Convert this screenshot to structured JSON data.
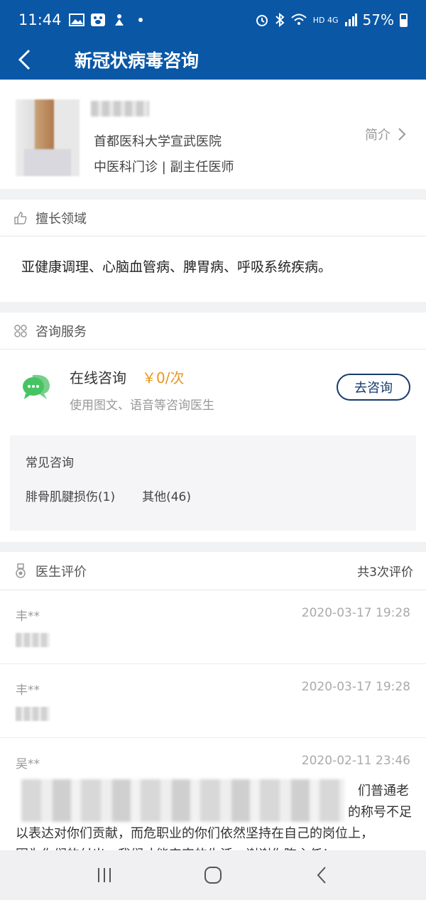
{
  "status_bar": {
    "time": "11:44",
    "battery": "57%",
    "signal": "HD 4G",
    "icons": [
      "image-icon",
      "paw-icon",
      "figure-icon",
      "dot-icon",
      "alarm-icon",
      "bluetooth-icon",
      "wifi-icon",
      "signal-icon",
      "battery-icon"
    ]
  },
  "header": {
    "title": "新冠状病毒咨询"
  },
  "doctor": {
    "hospital": "首都医科大学宣武医院",
    "department": "中医科门诊 | 副主任医师",
    "intro_label": "简介"
  },
  "specialty": {
    "heading": "擅长领域",
    "text": "亚健康调理、心脑血管病、脾胃病、呼吸系统疾病。"
  },
  "consult": {
    "heading": "咨询服务",
    "online_label": "在线咨询",
    "price": "￥0/次",
    "description": "使用图文、语音等咨询医生",
    "button_label": "去咨询",
    "faq_title": "常见咨询",
    "faq_tags": [
      "腓骨肌腱损伤(1)",
      "其他(46)"
    ]
  },
  "reviews": {
    "heading": "医生评价",
    "count_label": "共3次评价",
    "items": [
      {
        "user": "丰**",
        "time": "2020-03-17 19:28"
      },
      {
        "user": "丰**",
        "time": "2020-03-17 19:28"
      },
      {
        "user": "吴**",
        "time": "2020-02-11 23:46",
        "line1_tail": "们普通老",
        "line2_tail": "的称号不足",
        "line3": "以表达对你们贡献，而危职业的你们依然坚持在自己的岗位上，",
        "line4": "因为你们的付出，我们才能安定的生活，谢谢你陈主任！"
      }
    ]
  },
  "colors": {
    "brand": "#0a57a6",
    "price": "#e8961e",
    "button_border": "#153a6e"
  }
}
